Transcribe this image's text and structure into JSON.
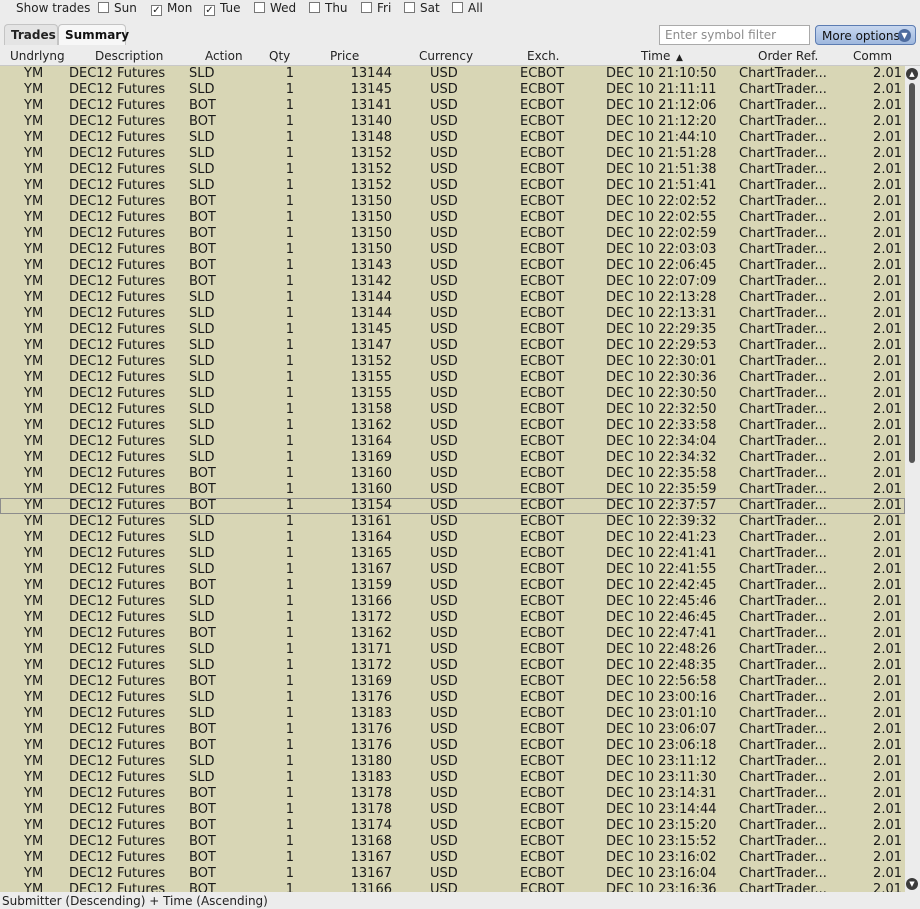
{
  "toolbar": {
    "show_trades_label": "Show trades",
    "days": [
      {
        "label": "Sun",
        "checked": false
      },
      {
        "label": "Mon",
        "checked": true
      },
      {
        "label": "Tue",
        "checked": true
      },
      {
        "label": "Wed",
        "checked": false
      },
      {
        "label": "Thu",
        "checked": false
      },
      {
        "label": "Fri",
        "checked": false
      },
      {
        "label": "Sat",
        "checked": false
      },
      {
        "label": "All",
        "checked": false
      }
    ],
    "check_glyph": "✓",
    "uncheck_glyph": ""
  },
  "tabs": [
    {
      "label": "Trades",
      "active": false
    },
    {
      "label": "Summary",
      "active": true
    }
  ],
  "filter": {
    "placeholder": "Enter symbol filter",
    "value": ""
  },
  "more_options": {
    "label": "More options",
    "icon": "chevron-down-icon"
  },
  "table": {
    "columns": [
      "Undrlyng",
      "Description",
      "Action",
      "Qty",
      "Price",
      "Currency",
      "Exch.",
      "Time",
      "Order Ref.",
      "Comm"
    ],
    "sort_indicator": "▲",
    "rows": [
      [
        "YM",
        "DEC12 Futures",
        "SLD",
        "1",
        "13144",
        "USD",
        "ECBOT",
        "DEC 10 21:10:50",
        "ChartTrader...",
        "2.01"
      ],
      [
        "YM",
        "DEC12 Futures",
        "SLD",
        "1",
        "13145",
        "USD",
        "ECBOT",
        "DEC 10 21:11:11",
        "ChartTrader...",
        "2.01"
      ],
      [
        "YM",
        "DEC12 Futures",
        "BOT",
        "1",
        "13141",
        "USD",
        "ECBOT",
        "DEC 10 21:12:06",
        "ChartTrader...",
        "2.01"
      ],
      [
        "YM",
        "DEC12 Futures",
        "BOT",
        "1",
        "13140",
        "USD",
        "ECBOT",
        "DEC 10 21:12:20",
        "ChartTrader...",
        "2.01"
      ],
      [
        "YM",
        "DEC12 Futures",
        "SLD",
        "1",
        "13148",
        "USD",
        "ECBOT",
        "DEC 10 21:44:10",
        "ChartTrader...",
        "2.01"
      ],
      [
        "YM",
        "DEC12 Futures",
        "SLD",
        "1",
        "13152",
        "USD",
        "ECBOT",
        "DEC 10 21:51:28",
        "ChartTrader...",
        "2.01"
      ],
      [
        "YM",
        "DEC12 Futures",
        "SLD",
        "1",
        "13152",
        "USD",
        "ECBOT",
        "DEC 10 21:51:38",
        "ChartTrader...",
        "2.01"
      ],
      [
        "YM",
        "DEC12 Futures",
        "SLD",
        "1",
        "13152",
        "USD",
        "ECBOT",
        "DEC 10 21:51:41",
        "ChartTrader...",
        "2.01"
      ],
      [
        "YM",
        "DEC12 Futures",
        "BOT",
        "1",
        "13150",
        "USD",
        "ECBOT",
        "DEC 10 22:02:52",
        "ChartTrader...",
        "2.01"
      ],
      [
        "YM",
        "DEC12 Futures",
        "BOT",
        "1",
        "13150",
        "USD",
        "ECBOT",
        "DEC 10 22:02:55",
        "ChartTrader...",
        "2.01"
      ],
      [
        "YM",
        "DEC12 Futures",
        "BOT",
        "1",
        "13150",
        "USD",
        "ECBOT",
        "DEC 10 22:02:59",
        "ChartTrader...",
        "2.01"
      ],
      [
        "YM",
        "DEC12 Futures",
        "BOT",
        "1",
        "13150",
        "USD",
        "ECBOT",
        "DEC 10 22:03:03",
        "ChartTrader...",
        "2.01"
      ],
      [
        "YM",
        "DEC12 Futures",
        "BOT",
        "1",
        "13143",
        "USD",
        "ECBOT",
        "DEC 10 22:06:45",
        "ChartTrader...",
        "2.01"
      ],
      [
        "YM",
        "DEC12 Futures",
        "BOT",
        "1",
        "13142",
        "USD",
        "ECBOT",
        "DEC 10 22:07:09",
        "ChartTrader...",
        "2.01"
      ],
      [
        "YM",
        "DEC12 Futures",
        "SLD",
        "1",
        "13144",
        "USD",
        "ECBOT",
        "DEC 10 22:13:28",
        "ChartTrader...",
        "2.01"
      ],
      [
        "YM",
        "DEC12 Futures",
        "SLD",
        "1",
        "13144",
        "USD",
        "ECBOT",
        "DEC 10 22:13:31",
        "ChartTrader...",
        "2.01"
      ],
      [
        "YM",
        "DEC12 Futures",
        "SLD",
        "1",
        "13145",
        "USD",
        "ECBOT",
        "DEC 10 22:29:35",
        "ChartTrader...",
        "2.01"
      ],
      [
        "YM",
        "DEC12 Futures",
        "SLD",
        "1",
        "13147",
        "USD",
        "ECBOT",
        "DEC 10 22:29:53",
        "ChartTrader...",
        "2.01"
      ],
      [
        "YM",
        "DEC12 Futures",
        "SLD",
        "1",
        "13152",
        "USD",
        "ECBOT",
        "DEC 10 22:30:01",
        "ChartTrader...",
        "2.01"
      ],
      [
        "YM",
        "DEC12 Futures",
        "SLD",
        "1",
        "13155",
        "USD",
        "ECBOT",
        "DEC 10 22:30:36",
        "ChartTrader...",
        "2.01"
      ],
      [
        "YM",
        "DEC12 Futures",
        "SLD",
        "1",
        "13155",
        "USD",
        "ECBOT",
        "DEC 10 22:30:50",
        "ChartTrader...",
        "2.01"
      ],
      [
        "YM",
        "DEC12 Futures",
        "SLD",
        "1",
        "13158",
        "USD",
        "ECBOT",
        "DEC 10 22:32:50",
        "ChartTrader...",
        "2.01"
      ],
      [
        "YM",
        "DEC12 Futures",
        "SLD",
        "1",
        "13162",
        "USD",
        "ECBOT",
        "DEC 10 22:33:58",
        "ChartTrader...",
        "2.01"
      ],
      [
        "YM",
        "DEC12 Futures",
        "SLD",
        "1",
        "13164",
        "USD",
        "ECBOT",
        "DEC 10 22:34:04",
        "ChartTrader...",
        "2.01"
      ],
      [
        "YM",
        "DEC12 Futures",
        "SLD",
        "1",
        "13169",
        "USD",
        "ECBOT",
        "DEC 10 22:34:32",
        "ChartTrader...",
        "2.01"
      ],
      [
        "YM",
        "DEC12 Futures",
        "BOT",
        "1",
        "13160",
        "USD",
        "ECBOT",
        "DEC 10 22:35:58",
        "ChartTrader...",
        "2.01"
      ],
      [
        "YM",
        "DEC12 Futures",
        "BOT",
        "1",
        "13160",
        "USD",
        "ECBOT",
        "DEC 10 22:35:59",
        "ChartTrader...",
        "2.01"
      ],
      [
        "YM",
        "DEC12 Futures",
        "BOT",
        "1",
        "13154",
        "USD",
        "ECBOT",
        "DEC 10 22:37:57",
        "ChartTrader...",
        "2.01"
      ],
      [
        "YM",
        "DEC12 Futures",
        "SLD",
        "1",
        "13161",
        "USD",
        "ECBOT",
        "DEC 10 22:39:32",
        "ChartTrader...",
        "2.01"
      ],
      [
        "YM",
        "DEC12 Futures",
        "SLD",
        "1",
        "13164",
        "USD",
        "ECBOT",
        "DEC 10 22:41:23",
        "ChartTrader...",
        "2.01"
      ],
      [
        "YM",
        "DEC12 Futures",
        "SLD",
        "1",
        "13165",
        "USD",
        "ECBOT",
        "DEC 10 22:41:41",
        "ChartTrader...",
        "2.01"
      ],
      [
        "YM",
        "DEC12 Futures",
        "SLD",
        "1",
        "13167",
        "USD",
        "ECBOT",
        "DEC 10 22:41:55",
        "ChartTrader...",
        "2.01"
      ],
      [
        "YM",
        "DEC12 Futures",
        "BOT",
        "1",
        "13159",
        "USD",
        "ECBOT",
        "DEC 10 22:42:45",
        "ChartTrader...",
        "2.01"
      ],
      [
        "YM",
        "DEC12 Futures",
        "SLD",
        "1",
        "13166",
        "USD",
        "ECBOT",
        "DEC 10 22:45:46",
        "ChartTrader...",
        "2.01"
      ],
      [
        "YM",
        "DEC12 Futures",
        "SLD",
        "1",
        "13172",
        "USD",
        "ECBOT",
        "DEC 10 22:46:45",
        "ChartTrader...",
        "2.01"
      ],
      [
        "YM",
        "DEC12 Futures",
        "BOT",
        "1",
        "13162",
        "USD",
        "ECBOT",
        "DEC 10 22:47:41",
        "ChartTrader...",
        "2.01"
      ],
      [
        "YM",
        "DEC12 Futures",
        "SLD",
        "1",
        "13171",
        "USD",
        "ECBOT",
        "DEC 10 22:48:26",
        "ChartTrader...",
        "2.01"
      ],
      [
        "YM",
        "DEC12 Futures",
        "SLD",
        "1",
        "13172",
        "USD",
        "ECBOT",
        "DEC 10 22:48:35",
        "ChartTrader...",
        "2.01"
      ],
      [
        "YM",
        "DEC12 Futures",
        "BOT",
        "1",
        "13169",
        "USD",
        "ECBOT",
        "DEC 10 22:56:58",
        "ChartTrader...",
        "2.01"
      ],
      [
        "YM",
        "DEC12 Futures",
        "SLD",
        "1",
        "13176",
        "USD",
        "ECBOT",
        "DEC 10 23:00:16",
        "ChartTrader...",
        "2.01"
      ],
      [
        "YM",
        "DEC12 Futures",
        "SLD",
        "1",
        "13183",
        "USD",
        "ECBOT",
        "DEC 10 23:01:10",
        "ChartTrader...",
        "2.01"
      ],
      [
        "YM",
        "DEC12 Futures",
        "BOT",
        "1",
        "13176",
        "USD",
        "ECBOT",
        "DEC 10 23:06:07",
        "ChartTrader...",
        "2.01"
      ],
      [
        "YM",
        "DEC12 Futures",
        "BOT",
        "1",
        "13176",
        "USD",
        "ECBOT",
        "DEC 10 23:06:18",
        "ChartTrader...",
        "2.01"
      ],
      [
        "YM",
        "DEC12 Futures",
        "SLD",
        "1",
        "13180",
        "USD",
        "ECBOT",
        "DEC 10 23:11:12",
        "ChartTrader...",
        "2.01"
      ],
      [
        "YM",
        "DEC12 Futures",
        "SLD",
        "1",
        "13183",
        "USD",
        "ECBOT",
        "DEC 10 23:11:30",
        "ChartTrader...",
        "2.01"
      ],
      [
        "YM",
        "DEC12 Futures",
        "BOT",
        "1",
        "13178",
        "USD",
        "ECBOT",
        "DEC 10 23:14:31",
        "ChartTrader...",
        "2.01"
      ],
      [
        "YM",
        "DEC12 Futures",
        "BOT",
        "1",
        "13178",
        "USD",
        "ECBOT",
        "DEC 10 23:14:44",
        "ChartTrader...",
        "2.01"
      ],
      [
        "YM",
        "DEC12 Futures",
        "BOT",
        "1",
        "13174",
        "USD",
        "ECBOT",
        "DEC 10 23:15:20",
        "ChartTrader...",
        "2.01"
      ],
      [
        "YM",
        "DEC12 Futures",
        "BOT",
        "1",
        "13168",
        "USD",
        "ECBOT",
        "DEC 10 23:15:52",
        "ChartTrader...",
        "2.01"
      ],
      [
        "YM",
        "DEC12 Futures",
        "BOT",
        "1",
        "13167",
        "USD",
        "ECBOT",
        "DEC 10 23:16:02",
        "ChartTrader...",
        "2.01"
      ],
      [
        "YM",
        "DEC12 Futures",
        "BOT",
        "1",
        "13167",
        "USD",
        "ECBOT",
        "DEC 10 23:16:04",
        "ChartTrader...",
        "2.01"
      ],
      [
        "YM",
        "DEC12 Futures",
        "BOT",
        "1",
        "13166",
        "USD",
        "ECBOT",
        "DEC 10 23:16:36",
        "ChartTrader...",
        "2.01"
      ]
    ],
    "selected_row_index": 27
  },
  "status_bar": {
    "sort_text": "Submitter (Descending)  +  Time (Ascending)"
  },
  "colors": {
    "grid_background": "#d8d6b5",
    "button_blue": "#9fb8de"
  }
}
